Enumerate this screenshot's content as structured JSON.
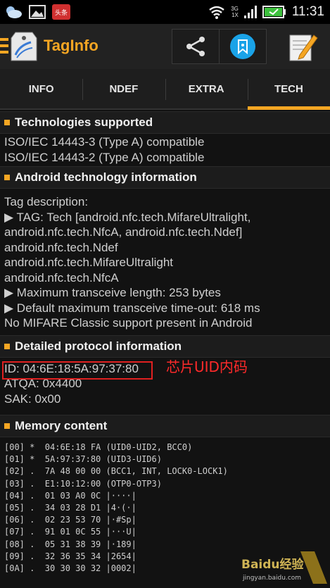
{
  "status_bar": {
    "time": "11:31",
    "network_top": "3G",
    "network_bottom": "1X",
    "notif_badge": "头条"
  },
  "app": {
    "title": "TagInfo"
  },
  "tabs": [
    {
      "label": "INFO",
      "active": false
    },
    {
      "label": "NDEF",
      "active": false
    },
    {
      "label": "EXTRA",
      "active": false
    },
    {
      "label": "TECH",
      "active": true
    }
  ],
  "colors": {
    "accent": "#f5a623",
    "highlight": "#e02020"
  },
  "sections": {
    "technologies": {
      "title": "Technologies supported",
      "lines": [
        "ISO/IEC 14443-3 (Type A) compatible",
        "ISO/IEC 14443-2 (Type A) compatible"
      ]
    },
    "android": {
      "title": "Android technology information",
      "tag_description_label": "Tag description:",
      "lines": [
        "▶ TAG: Tech [android.nfc.tech.MifareUltralight,",
        "android.nfc.tech.NfcA, android.nfc.tech.Ndef]",
        "android.nfc.tech.Ndef",
        "android.nfc.tech.MifareUltralight",
        "android.nfc.tech.NfcA",
        "▶ Maximum transceive length: 253 bytes",
        "▶ Default maximum transceive time-out: 618 ms",
        "No MIFARE Classic support present in Android"
      ]
    },
    "protocol": {
      "title": "Detailed protocol information",
      "id_line": "ID: 04:6E:18:5A:97:37:80",
      "annotation": "芯片UID内码",
      "atqa": "ATQA: 0x4400",
      "sak": "SAK: 0x00"
    },
    "memory": {
      "title": "Memory content",
      "rows": [
        "[00] *  04:6E:18 FA (UID0-UID2, BCC0)",
        "[01] *  5A:97:37:80 (UID3-UID6)",
        "[02] .  7A 48 00 00 (BCC1, INT, LOCK0-LOCK1)",
        "[03] .  E1:10:12:00 (OTP0-OTP3)",
        "[04] .  01 03 A0 0C |····|",
        "[05] .  34 03 28 D1 |4·(·|",
        "[06] .  02 23 53 70 |·#Sp|",
        "[07] .  91 01 0C 55 |···U|",
        "[08] .  05 31 38 39 |·189|",
        "[09] .  32 36 35 34 |2654|",
        "[0A] .  30 30 30 32 |0002|"
      ]
    }
  },
  "watermark": {
    "brand": "Baidu经验",
    "url": "jingyan.baidu.com"
  },
  "icons": [
    "weather-icon",
    "gallery-icon",
    "news-icon",
    "wifi-icon",
    "signal-icon",
    "battery-icon",
    "menu-icon",
    "app-logo-icon",
    "share-icon",
    "bookmark-icon",
    "edit-icon"
  ]
}
